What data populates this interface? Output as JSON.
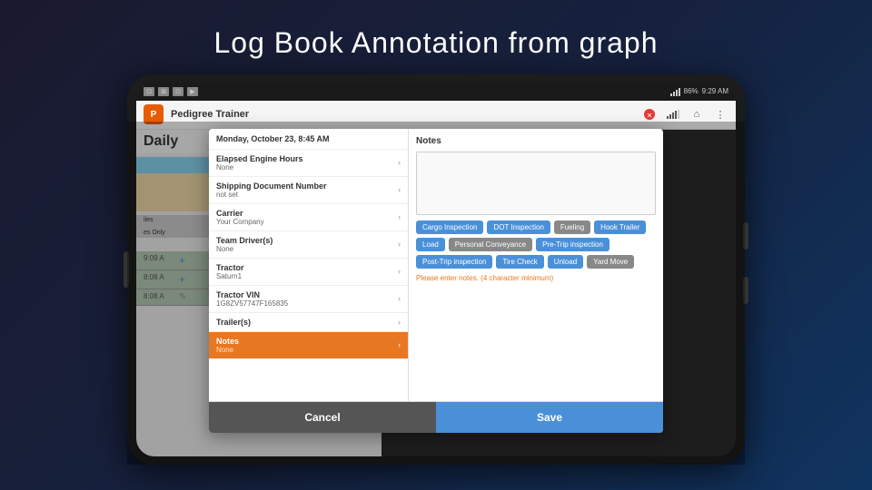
{
  "page": {
    "title": "Log Book Annotation from graph"
  },
  "statusBar": {
    "icons": [
      "■",
      "■",
      "■",
      "▶"
    ],
    "time": "9:29 AM",
    "battery": "86%"
  },
  "appBar": {
    "logo": "P",
    "name": "Pedigree Trainer",
    "icons": [
      "✕",
      "▐▐▐",
      "⌂",
      "⋮"
    ]
  },
  "leftPanel": {
    "dailyLabel": "Daily",
    "logRows": [
      {
        "time": "9:09 A",
        "content": ""
      },
      {
        "time": "8:08 A",
        "content": ""
      },
      {
        "time": "8:08 A",
        "content": ""
      }
    ]
  },
  "modal": {
    "date": "Monday, October 23, 8:45 AM",
    "rows": [
      {
        "label": "Elapsed Engine Hours",
        "value": "None",
        "active": false
      },
      {
        "label": "Shipping Document Number",
        "value": "not set",
        "active": false
      },
      {
        "label": "Carrier",
        "value": "Your Company",
        "active": false
      },
      {
        "label": "Team Driver(s)",
        "value": "None",
        "active": false
      },
      {
        "label": "Tractor",
        "value": "Saturn1",
        "active": false
      },
      {
        "label": "Tractor VIN",
        "value": "1G8ZV57747F165835",
        "active": false
      },
      {
        "label": "Trailer(s)",
        "value": "",
        "active": false
      },
      {
        "label": "Notes",
        "value": "None",
        "active": true
      }
    ],
    "notesSection": {
      "title": "Notes",
      "placeholder": "",
      "tags": [
        {
          "label": "Cargo Inspection",
          "color": "blue"
        },
        {
          "label": "DOT Inspection",
          "color": "blue"
        },
        {
          "label": "Fueling",
          "color": "gray"
        },
        {
          "label": "Hook Trailer",
          "color": "blue"
        },
        {
          "label": "Load",
          "color": "blue"
        },
        {
          "label": "Personal Conveyance",
          "color": "gray"
        },
        {
          "label": "Pre-Trip inspection",
          "color": "blue"
        },
        {
          "label": "Post-Trip inspection",
          "color": "blue"
        },
        {
          "label": "Tire Check",
          "color": "blue"
        },
        {
          "label": "Unload",
          "color": "blue"
        },
        {
          "label": "Yard Move",
          "color": "gray"
        }
      ],
      "errorText": "Please enter notes. (4 character minimum)"
    },
    "buttons": {
      "cancel": "Cancel",
      "save": "Save"
    }
  },
  "rightNav": {
    "icons": [
      "↩",
      "←",
      "≡"
    ]
  }
}
